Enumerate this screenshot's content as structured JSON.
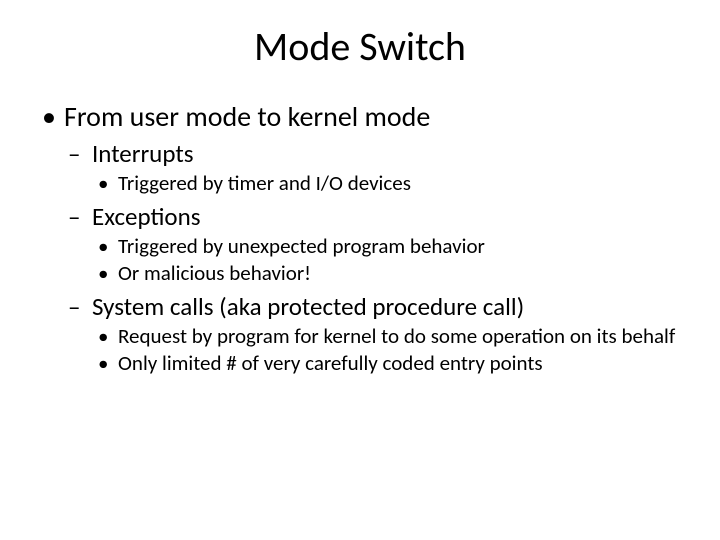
{
  "slide": {
    "title": "Mode Switch",
    "l1": {
      "a": "From user mode to kernel mode"
    },
    "l2": {
      "interrupts": "Interrupts",
      "exceptions": "Exceptions",
      "syscalls": "System calls (aka protected procedure call)"
    },
    "l3": {
      "interrupts_1": "Triggered by timer and I/O devices",
      "exceptions_1": "Triggered by unexpected program behavior",
      "exceptions_2": "Or malicious behavior!",
      "syscalls_1": "Request by program for kernel to do some operation on its behalf",
      "syscalls_2": "Only limited # of very carefully coded entry points"
    }
  }
}
